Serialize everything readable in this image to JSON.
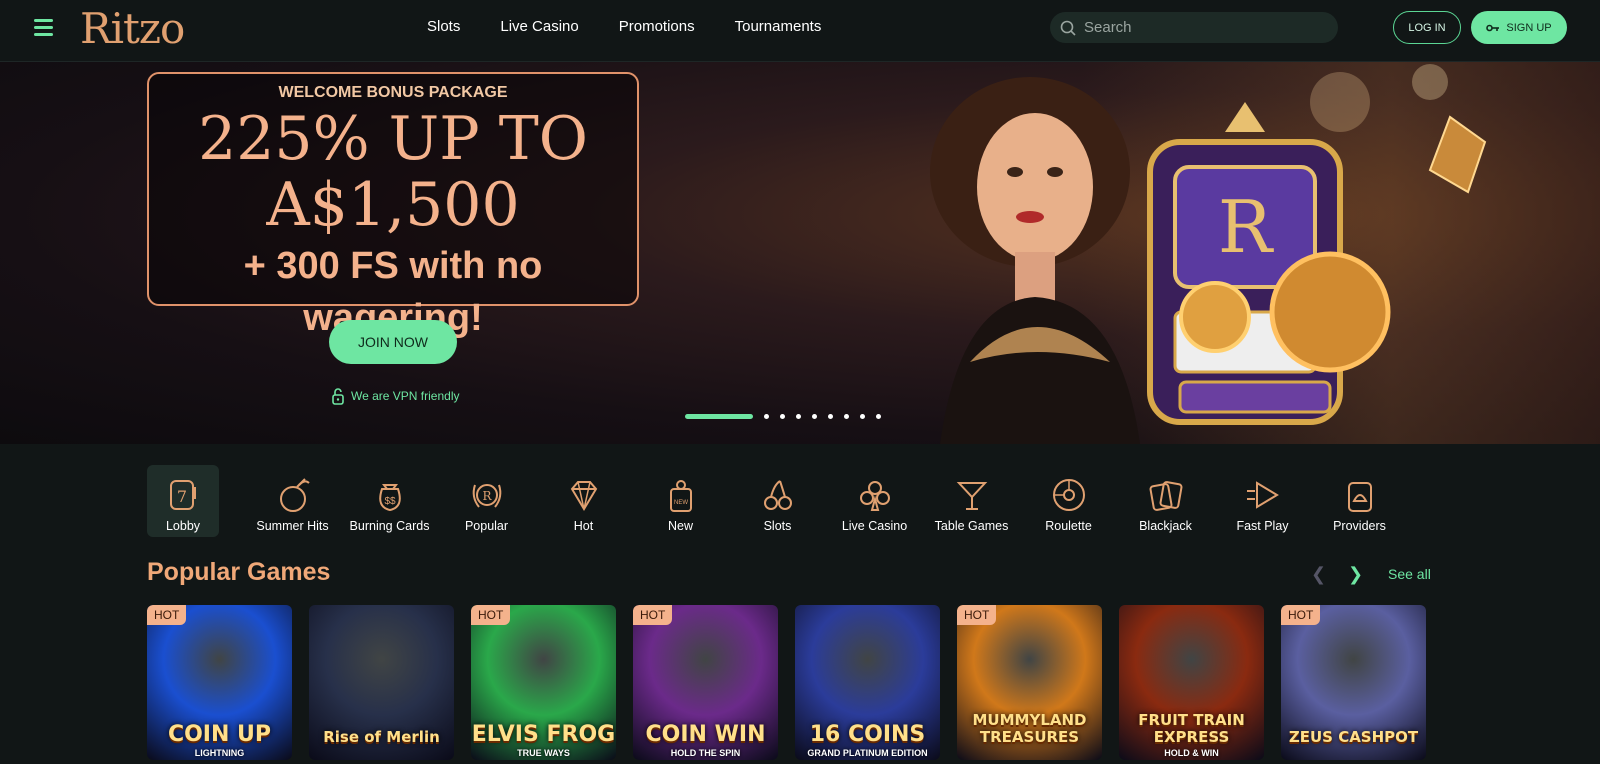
{
  "header": {
    "logo": "Ritzo",
    "nav": [
      "Slots",
      "Live Casino",
      "Promotions",
      "Tournaments"
    ],
    "search_placeholder": "Search",
    "login_label": "LOG IN",
    "signup_label": "SIGN UP"
  },
  "hero": {
    "eyebrow": "WELCOME BONUS PACKAGE",
    "line1": "225% UP TO",
    "line2": "A$1,500",
    "line3": "+ 300 FS with no wagering!",
    "cta_label": "JOIN NOW",
    "vpn_text": "We are VPN friendly",
    "slide_count": 9,
    "active_slide": 1,
    "slot_letter": "R"
  },
  "categories": [
    {
      "label": "Lobby",
      "icon": "slot-seven-icon",
      "active": true
    },
    {
      "label": "Summer Hits",
      "icon": "coconut-drink-icon"
    },
    {
      "label": "Burning Cards",
      "icon": "money-bag-icon"
    },
    {
      "label": "Popular",
      "icon": "laurel-badge-icon"
    },
    {
      "label": "Hot",
      "icon": "diamond-icon"
    },
    {
      "label": "New",
      "icon": "door-hanger-new-icon"
    },
    {
      "label": "Slots",
      "icon": "cherries-icon"
    },
    {
      "label": "Live Casino",
      "icon": "club-suit-icon"
    },
    {
      "label": "Table Games",
      "icon": "cocktail-icon"
    },
    {
      "label": "Roulette",
      "icon": "roulette-wheel-icon"
    },
    {
      "label": "Blackjack",
      "icon": "cards-icon"
    },
    {
      "label": "Fast Play",
      "icon": "fast-forward-icon"
    },
    {
      "label": "Providers",
      "icon": "provider-card-icon"
    }
  ],
  "popular": {
    "title": "Popular Games",
    "see_all": "See all",
    "games": [
      {
        "title": "COIN UP",
        "sub": "LIGHTNING",
        "badge": "HOT",
        "bg": "#1a4fd0"
      },
      {
        "title": "Rise of Merlin",
        "sub": "",
        "badge": "",
        "bg": "#27304a"
      },
      {
        "title": "ELVIS FROG",
        "sub": "TRUE WAYS",
        "badge": "HOT",
        "bg": "#2aa84a"
      },
      {
        "title": "COIN WIN",
        "sub": "HOLD THE SPIN",
        "badge": "HOT",
        "bg": "#6b2a8a"
      },
      {
        "title": "16 COINS",
        "sub": "GRAND PLATINUM EDITION",
        "badge": "",
        "bg": "#2b3c9a"
      },
      {
        "title": "MUMMYLAND TREASURES",
        "sub": "",
        "badge": "HOT",
        "bg": "#d0781a"
      },
      {
        "title": "FRUIT TRAIN EXPRESS",
        "sub": "HOLD & WIN",
        "badge": "",
        "bg": "#8a2a10"
      },
      {
        "title": "ZEUS CASHPOT",
        "sub": "",
        "badge": "HOT",
        "bg": "#5a5fa0"
      }
    ]
  }
}
